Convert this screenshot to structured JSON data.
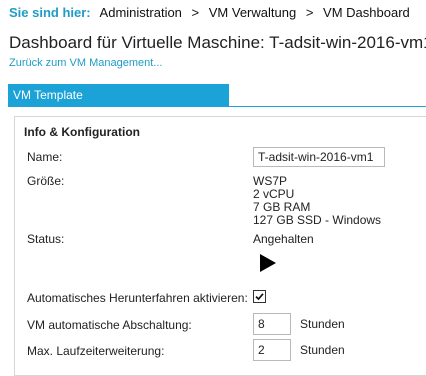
{
  "breadcrumb": {
    "prefix": "Sie sind hier:",
    "items": [
      "Administration",
      "VM Verwaltung",
      "VM Dashboard"
    ],
    "separator": ">"
  },
  "page": {
    "title": "Dashboard für Virtuelle Maschine: T-adsit-win-2016-vm1",
    "back_link": "Zurück zum VM Management..."
  },
  "tab": {
    "label": "VM Template"
  },
  "info": {
    "section_title": "Info & Konfiguration",
    "name_label": "Name:",
    "name_value": "T-adsit-win-2016-vm1",
    "size_label": "Größe:",
    "size_lines": [
      "WS7P",
      "2 vCPU",
      "7 GB RAM",
      "127 GB SSD - Windows"
    ],
    "status_label": "Status:",
    "status_value": "Angehalten",
    "play_icon": "play-icon",
    "auto_shutdown_label": "Automatisches Herunterfahren aktivieren:",
    "auto_shutdown_checked": true,
    "vm_auto_shutdown_label": "VM automatische Abschaltung:",
    "vm_auto_shutdown_value": "8",
    "vm_auto_shutdown_unit": "Stunden",
    "max_runtime_label": "Max. Laufzeiterweiterung:",
    "max_runtime_value": "2",
    "max_runtime_unit": "Stunden"
  },
  "colors": {
    "accent": "#1ba2d6",
    "link": "#1e9cc6"
  }
}
